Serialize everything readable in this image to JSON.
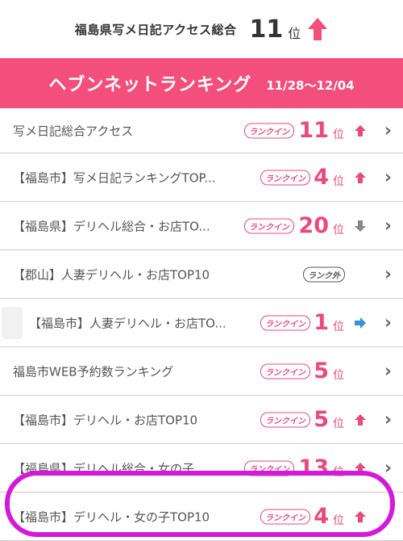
{
  "summary": {
    "label": "福島県写メ日記アクセス総合",
    "rank": "11",
    "unit": "位"
  },
  "header": {
    "title": "ヘブンネットランキング",
    "period": "11/28〜12/04"
  },
  "badge_in": "ランクイン",
  "badge_out": "ランク外",
  "rows": [
    {
      "label": "写メ日記総合アクセス",
      "status": "in",
      "rank": "11",
      "unit": "位",
      "trend": "up"
    },
    {
      "label": "【福島市】写メ日記ランキングTOP...",
      "status": "in",
      "rank": "4",
      "unit": "位",
      "trend": "up"
    },
    {
      "label": "【福島県】デリヘル総合・お店TO...",
      "status": "in",
      "rank": "20",
      "unit": "位",
      "trend": "down"
    },
    {
      "label": "【郡山】人妻デリヘル・お店TOP10",
      "status": "out",
      "rank": "",
      "unit": "",
      "trend": "none"
    },
    {
      "label": "【福島市】人妻デリヘル・お店TO...",
      "status": "in",
      "rank": "1",
      "unit": "位",
      "trend": "same"
    },
    {
      "label": "福島市WEB予約数ランキング",
      "status": "in",
      "rank": "5",
      "unit": "位",
      "trend": "none"
    },
    {
      "label": "【福島市】デリヘル・お店TOP10",
      "status": "in",
      "rank": "5",
      "unit": "位",
      "trend": "up"
    },
    {
      "label": "【福島県】デリヘル総合・女の子...",
      "status": "in",
      "rank": "13",
      "unit": "位",
      "trend": "up"
    },
    {
      "label": "【福島市】デリヘル・女の子TOP10",
      "status": "in",
      "rank": "4",
      "unit": "位",
      "trend": "up"
    }
  ],
  "colors": {
    "accent": "#f24f7c",
    "rank": "#e84a7c",
    "up": "#e84a7c",
    "down": "#888888",
    "same": "#3b8fd6",
    "highlight": "#d21ad8"
  }
}
